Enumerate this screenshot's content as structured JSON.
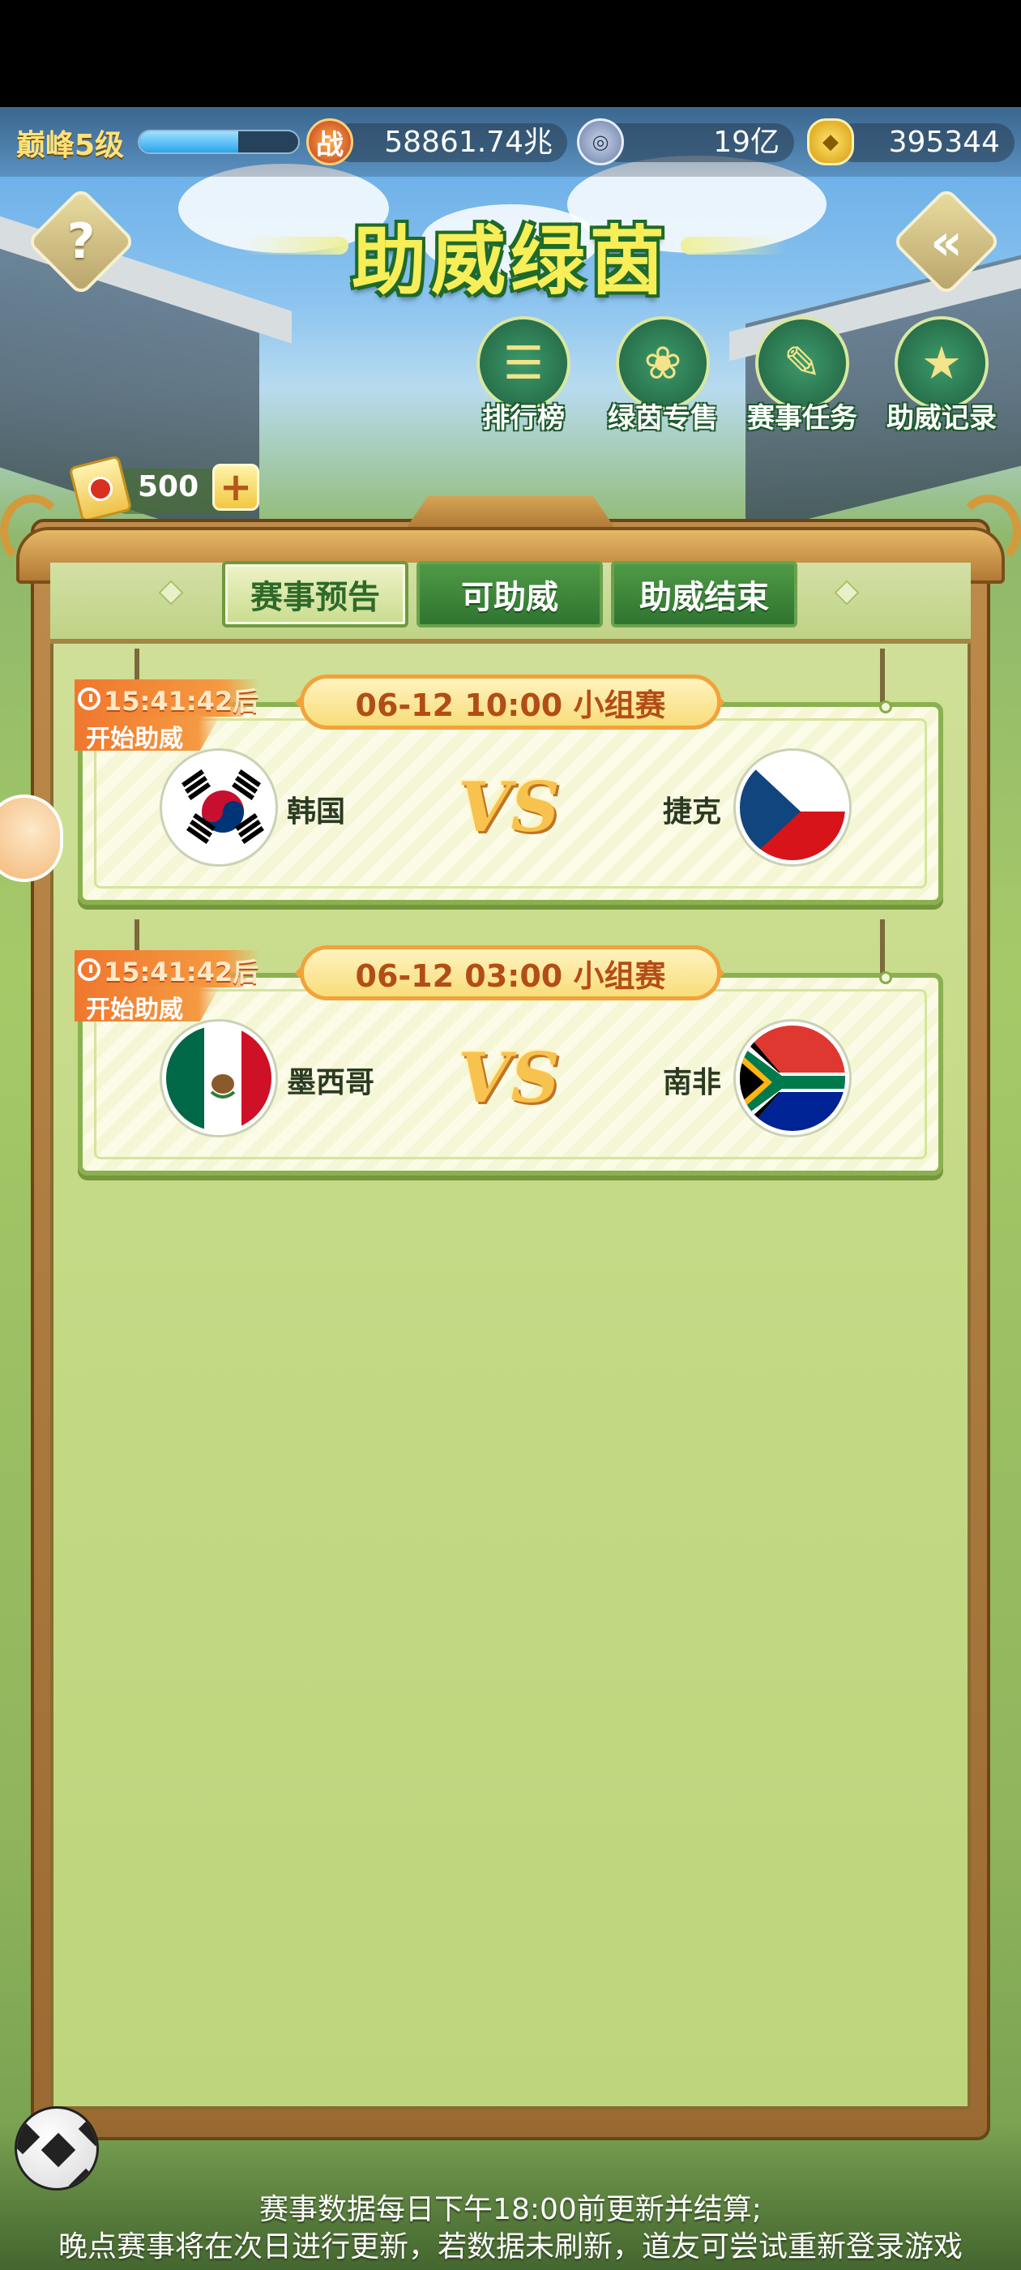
{
  "resources": {
    "level": "巅峰5级",
    "exp_fraction": 0.62,
    "combat_icon": "战",
    "combat_power": "58861.74兆",
    "coin_icon": "silver-coin-icon",
    "coins": "19亿",
    "gold_icon": "gold-ingot-icon",
    "gold": "395344"
  },
  "header": {
    "title": "助威绿茵",
    "help_symbol": "?",
    "back_symbol": "«"
  },
  "menu": [
    {
      "label": "排行榜",
      "icon": "leaderboard-icon",
      "glyph": "☰"
    },
    {
      "label": "绿茵专售",
      "icon": "gift-bag-icon",
      "glyph": "❀"
    },
    {
      "label": "赛事任务",
      "icon": "scroll-icon",
      "glyph": "✎"
    },
    {
      "label": "助威记录",
      "icon": "medal-icon",
      "glyph": "★"
    }
  ],
  "tickets": {
    "count": "500",
    "add_symbol": "+"
  },
  "tabs": [
    {
      "label": "赛事预告",
      "active": true
    },
    {
      "label": "可助威",
      "active": false
    },
    {
      "label": "助威结束",
      "active": false
    }
  ],
  "matches": [
    {
      "countdown": "15:41:42后",
      "countdown_sub": "开始助威",
      "schedule": "06-12 10:00 小组赛",
      "home": "韩国",
      "away": "捷克",
      "vs": "VS"
    },
    {
      "countdown": "15:41:42后",
      "countdown_sub": "开始助威",
      "schedule": "06-12 03:00 小组赛",
      "home": "墨西哥",
      "away": "南非",
      "vs": "VS"
    }
  ],
  "footer": {
    "line1": "赛事数据每日下午18:00前更新并结算;",
    "line2": "晚点赛事将在次日进行更新，若数据未刷新，道友可尝试重新登录游戏"
  }
}
